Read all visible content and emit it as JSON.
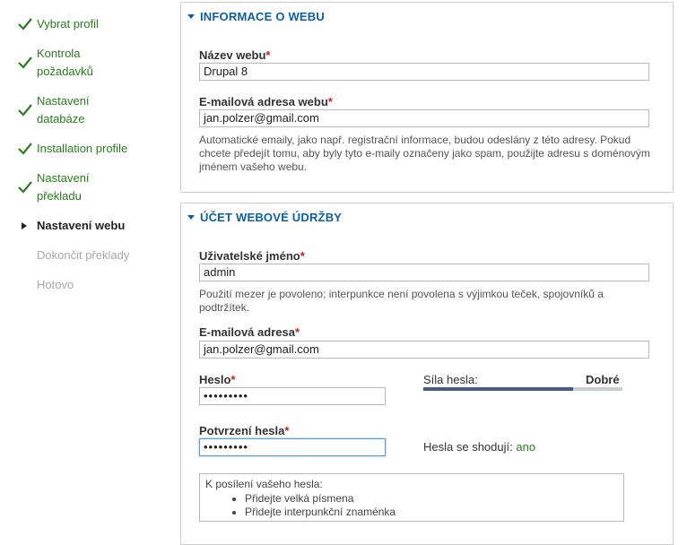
{
  "sidebar": {
    "steps": [
      {
        "label": "Vybrat profil",
        "state": "done"
      },
      {
        "label": "Kontrola požadavků",
        "lines": [
          "Kontrola",
          "požadavků"
        ],
        "state": "done"
      },
      {
        "label": "Nastavení databáze",
        "lines": [
          "Nastavení",
          "databáze"
        ],
        "state": "done"
      },
      {
        "label": "Installation profile",
        "state": "done"
      },
      {
        "label": "Nastavení překladu",
        "lines": [
          "Nastavení",
          "překladu"
        ],
        "state": "done"
      },
      {
        "label": "Nastavení webu",
        "state": "current"
      },
      {
        "label": "Dokončit překlady",
        "state": "todo"
      },
      {
        "label": "Hotovo",
        "state": "todo"
      }
    ]
  },
  "site_info": {
    "legend": "INFORMACE O WEBU",
    "site_name_label": "Název webu",
    "site_name_value": "Drupal 8",
    "site_mail_label": "E-mailová adresa webu",
    "site_mail_value": "jan.polzer@gmail.com",
    "site_mail_desc": "Automatické emaily, jako např. registrační informace, budou odeslány z této adresy. Pokud chcete předejít tomu, aby byly tyto e-maily označeny jako spam, použijte adresu s doménovým jménem vašeho webu."
  },
  "account": {
    "legend": "ÚČET WEBOVÉ ÚDRŽBY",
    "username_label": "Uživatelské jméno",
    "username_value": "admin",
    "username_desc": "Použití mezer je povoleno; interpunkce není povolena s výjimkou teček, spojovníků a podtržítek.",
    "mail_label": "E-mailová adresa",
    "mail_value": "jan.polzer@gmail.com",
    "pass_label": "Heslo",
    "pass_value": "•••••••••",
    "strength_label": "Síla hesla:",
    "strength_value": "Dobré",
    "strength_fraction": 0.75,
    "confirm_label": "Potvrzení hesla",
    "confirm_value": "•••••••••",
    "match_label": "Hesla se shodují:",
    "match_value": "ano",
    "tips_title": "K posílení vašeho hesla:",
    "tips": [
      "Přidejte velká písmena",
      "Přidejte interpunkční znaménka"
    ]
  },
  "required_marker": "*",
  "colors": {
    "done": "#2a7d1f",
    "legend": "#0b5fa5",
    "required": "#d11a1a",
    "strength_fill": "#4a5c86"
  }
}
